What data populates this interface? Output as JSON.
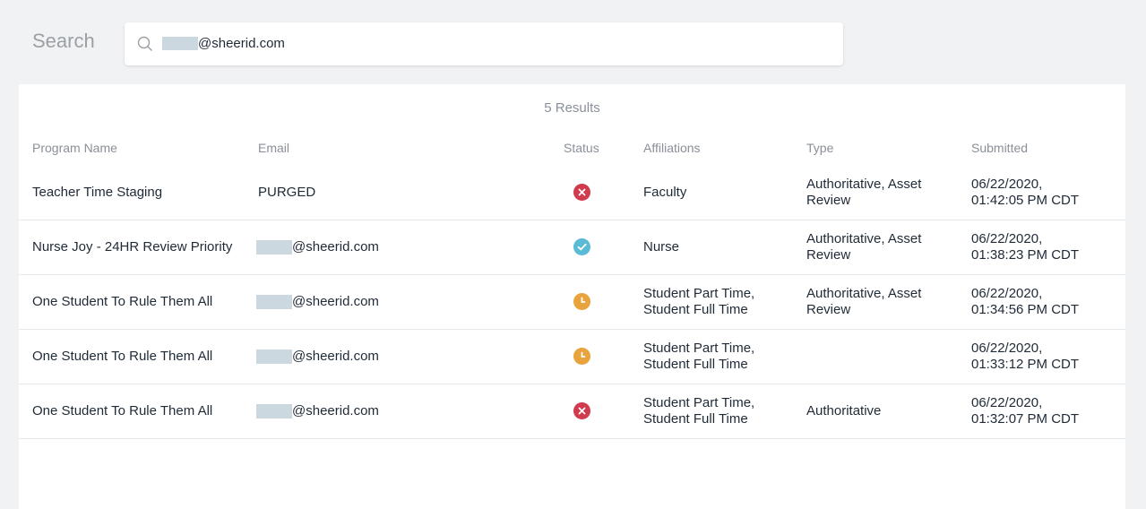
{
  "search": {
    "label": "Search",
    "value_suffix": "@sheerid.com"
  },
  "results": {
    "count_label": "5 Results"
  },
  "columns": [
    "Program Name",
    "Email",
    "Status",
    "Affiliations",
    "Type",
    "Submitted"
  ],
  "status_colors": {
    "rejected": "#d03b4e",
    "verified": "#5bbad5",
    "pending": "#e8a33d"
  },
  "rows": [
    {
      "program": "Teacher Time Staging",
      "email_redacted": false,
      "email": "PURGED",
      "status": "rejected",
      "status_icon": "x-circle-icon",
      "affiliations": [
        "Faculty"
      ],
      "type": [
        "Authoritative, Asset",
        "Review"
      ],
      "submitted": [
        "06/22/2020,",
        "01:42:05 PM CDT"
      ]
    },
    {
      "program": "Nurse Joy - 24HR Review Priority",
      "email_redacted": true,
      "email": "@sheerid.com",
      "status": "verified",
      "status_icon": "check-circle-icon",
      "affiliations": [
        "Nurse"
      ],
      "type": [
        "Authoritative, Asset",
        "Review"
      ],
      "submitted": [
        "06/22/2020,",
        "01:38:23 PM CDT"
      ]
    },
    {
      "program": "One Student To Rule Them All",
      "email_redacted": true,
      "email": "@sheerid.com",
      "status": "pending",
      "status_icon": "clock-icon",
      "affiliations": [
        "Student Part Time,",
        "Student Full Time"
      ],
      "type": [
        "Authoritative, Asset",
        "Review"
      ],
      "submitted": [
        "06/22/2020,",
        "01:34:56 PM CDT"
      ]
    },
    {
      "program": "One Student To Rule Them All",
      "email_redacted": true,
      "email": "@sheerid.com",
      "status": "pending",
      "status_icon": "clock-icon",
      "affiliations": [
        "Student Part Time,",
        "Student Full Time"
      ],
      "type": [],
      "submitted": [
        "06/22/2020,",
        "01:33:12 PM CDT"
      ]
    },
    {
      "program": "One Student To Rule Them All",
      "email_redacted": true,
      "email": "@sheerid.com",
      "status": "rejected",
      "status_icon": "x-circle-icon",
      "affiliations": [
        "Student Part Time,",
        "Student Full Time"
      ],
      "type": [
        "Authoritative"
      ],
      "submitted": [
        "06/22/2020,",
        "01:32:07 PM CDT"
      ]
    }
  ]
}
